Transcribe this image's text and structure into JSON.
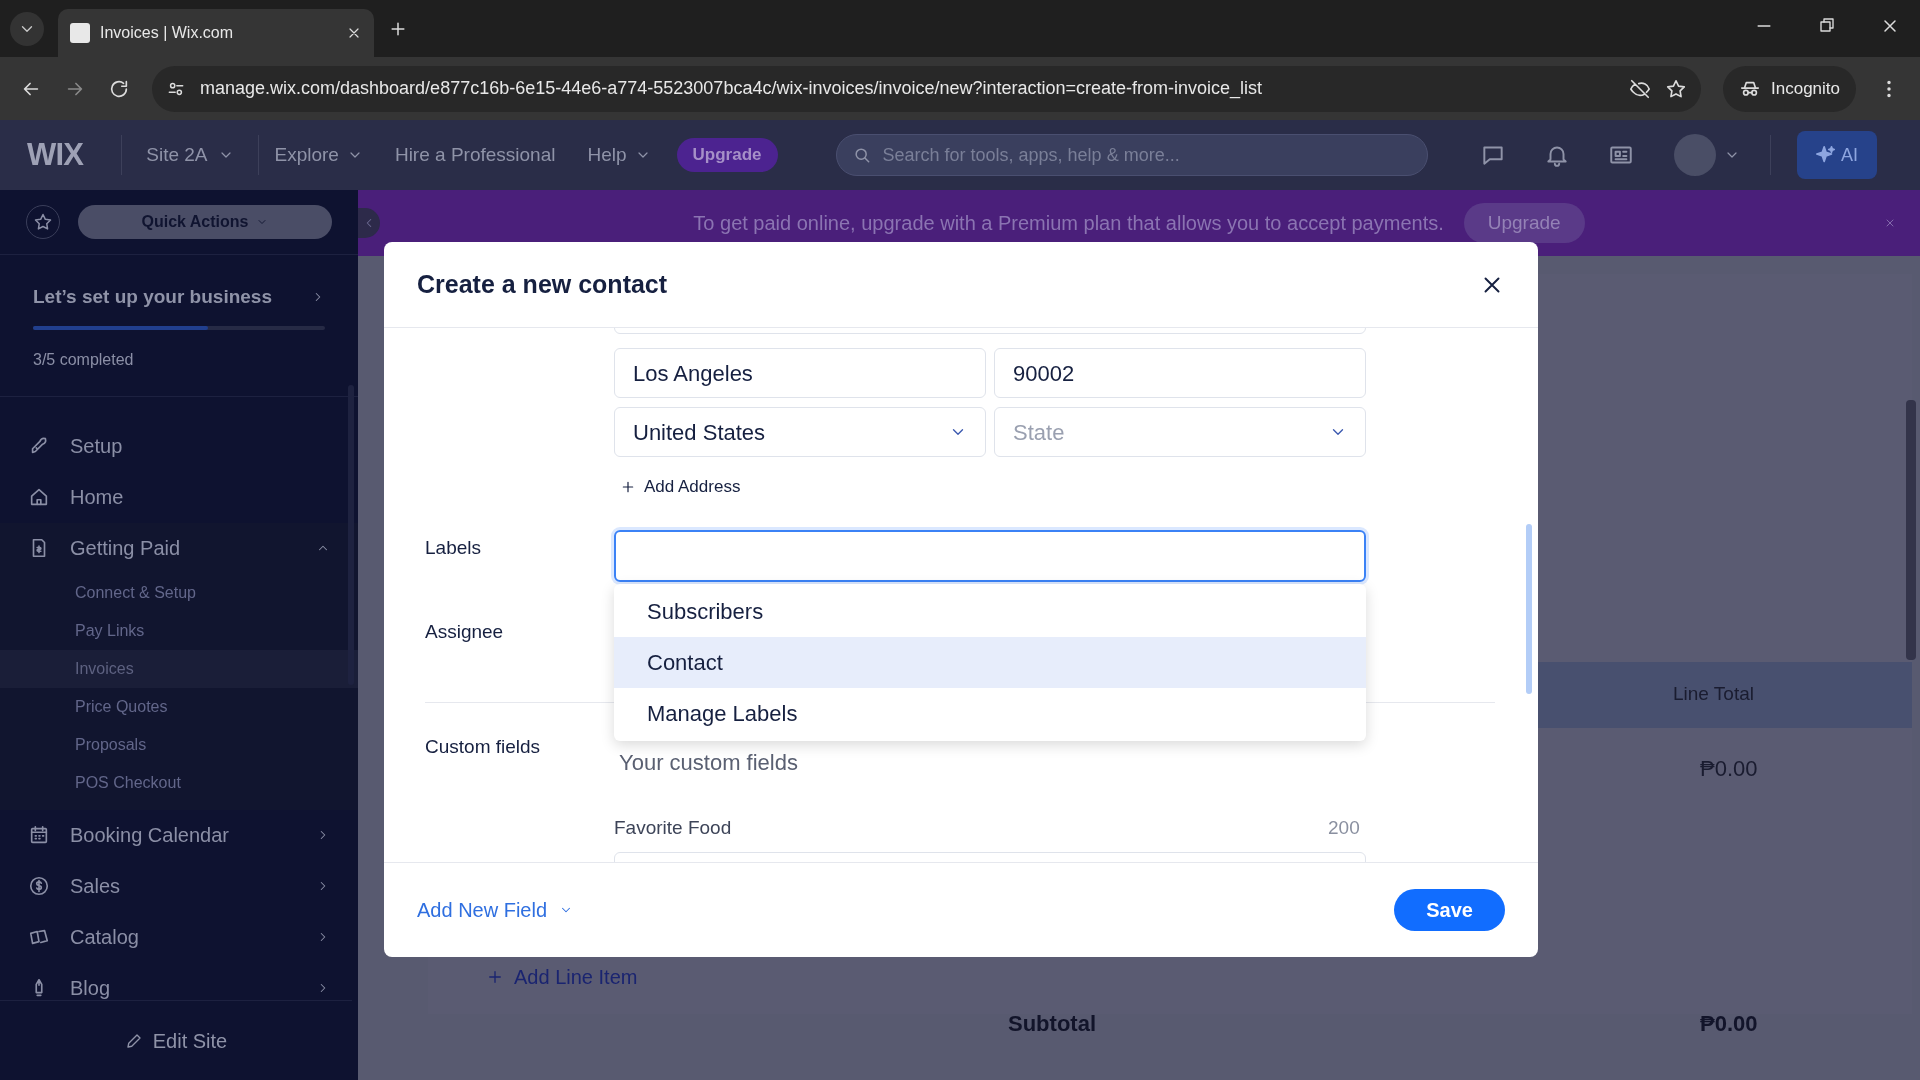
{
  "browser": {
    "tab_title": "Invoices | Wix.com",
    "url": "manage.wix.com/dashboard/e877c16b-6e15-44e6-a774-5523007bca4c/wix-invoices/invoice/new?interaction=create-from-invoice_list",
    "profile": "Incognito"
  },
  "top_bar": {
    "logo": "WIX",
    "site": "Site 2A",
    "nav": [
      "Explore",
      "Hire a Professional",
      "Help"
    ],
    "upgrade": "Upgrade",
    "search": {
      "placeholder": "Search for tools, apps, help & more..."
    },
    "ai": "AI"
  },
  "sidebar": {
    "quick_actions": "Quick Actions",
    "setup_title": "Let’s set up your business",
    "progress": {
      "level": 0.6
    },
    "progress_text": "3/5 completed",
    "items": [
      {
        "label": "Setup"
      },
      {
        "label": "Home"
      },
      {
        "label": "Getting Paid",
        "expanded": true,
        "children": [
          {
            "label": "Connect & Setup",
            "selected": false
          },
          {
            "label": "Pay Links",
            "selected": false
          },
          {
            "label": "Invoices",
            "selected": true
          },
          {
            "label": "Price Quotes",
            "selected": false
          },
          {
            "label": "Proposals",
            "selected": false
          },
          {
            "label": "POS Checkout",
            "selected": false
          }
        ]
      },
      {
        "label": "Booking Calendar"
      },
      {
        "label": "Sales"
      },
      {
        "label": "Catalog"
      },
      {
        "label": "Blog"
      }
    ],
    "edit_site": "Edit Site"
  },
  "banner": {
    "text": "To get paid online, upgrade with a Premium plan that allows you to accept payments.",
    "button": "Upgrade"
  },
  "invoice": {
    "column": "Line Total",
    "amount": "₱0.00",
    "add_line_item": "Add Line Item",
    "subtotal_label": "Subtotal",
    "subtotal": "₱0.00"
  },
  "modal": {
    "title": "Create a new contact",
    "city": "Los Angeles",
    "zip": "90002",
    "country": "United States",
    "state": {
      "placeholder": "State"
    },
    "add_address": "Add Address",
    "labels_label": "Labels",
    "label_options": [
      {
        "label": "Subscribers",
        "selected": false
      },
      {
        "label": "Contact",
        "selected": true
      },
      {
        "label": "Manage Labels",
        "selected": false
      }
    ],
    "assignee_label": "Assignee",
    "custom_label": "Custom fields",
    "custom_hint": "Your custom fields",
    "custom_field": {
      "label": "Favorite Food",
      "counter": "200"
    },
    "add_new_field": "Add New Field",
    "save": "Save"
  }
}
